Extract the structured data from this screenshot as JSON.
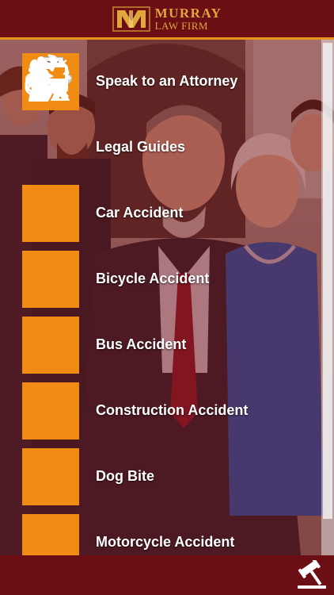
{
  "header": {
    "logo_monogram": "MI",
    "logo_line1": "MURRAY",
    "logo_line2": "LAW FIRM"
  },
  "menu": {
    "items": [
      {
        "label": "Speak to an Attorney",
        "icon": "phone-icon"
      },
      {
        "label": "Legal Guides",
        "icon": "book-icon"
      },
      {
        "label": "Car Accident",
        "icon": "car-crash-icon"
      },
      {
        "label": "Bicycle Accident",
        "icon": "bicycle-icon"
      },
      {
        "label": "Bus Accident",
        "icon": "bus-icon"
      },
      {
        "label": "Construction Accident",
        "icon": "construction-worker-icon"
      },
      {
        "label": "Dog Bite",
        "icon": "dog-bite-icon"
      },
      {
        "label": "Motorcycle Accident",
        "icon": "motorcycle-icon"
      }
    ]
  },
  "footer": {
    "icon": "gavel-icon"
  },
  "colors": {
    "brand_maroon": "#6b0f14",
    "accent_orange": "#f08c14",
    "logo_gold": "#e0a83a"
  }
}
